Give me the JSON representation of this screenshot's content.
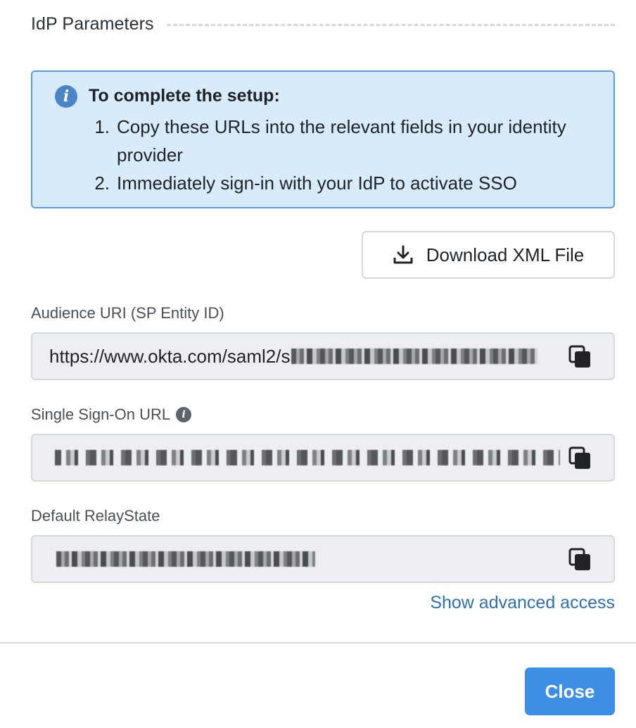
{
  "section": {
    "title": "IdP Parameters"
  },
  "callout": {
    "icon": "info-circle-icon",
    "title": "To complete the setup:",
    "steps": [
      {
        "num": "1.",
        "text": "Copy these URLs into the relevant fields in your identity provider"
      },
      {
        "num": "2.",
        "text": "Immediately sign-in with your IdP to activate SSO"
      }
    ],
    "colors": {
      "background": "#d8ebfb",
      "border": "#5b9de0",
      "icon": "#4a85c7"
    }
  },
  "download_button": {
    "label": "Download XML File",
    "icon": "download-icon"
  },
  "fields": {
    "audience_uri": {
      "label": "Audience URI (SP Entity ID)",
      "value": "https://www.okta.com/saml2/s",
      "copy_icon": "copy-icon"
    },
    "sso_url": {
      "label": "Single Sign-On URL",
      "info_icon": "info-icon",
      "copy_icon": "copy-icon"
    },
    "relay_state": {
      "label": "Default RelayState",
      "copy_icon": "copy-icon"
    }
  },
  "advanced_link": {
    "label": "Show advanced access"
  },
  "footer": {
    "close_label": "Close"
  },
  "colors": {
    "accent": "#3d8fe6",
    "link": "#2f6fb3",
    "field_bg": "#eceef1"
  }
}
